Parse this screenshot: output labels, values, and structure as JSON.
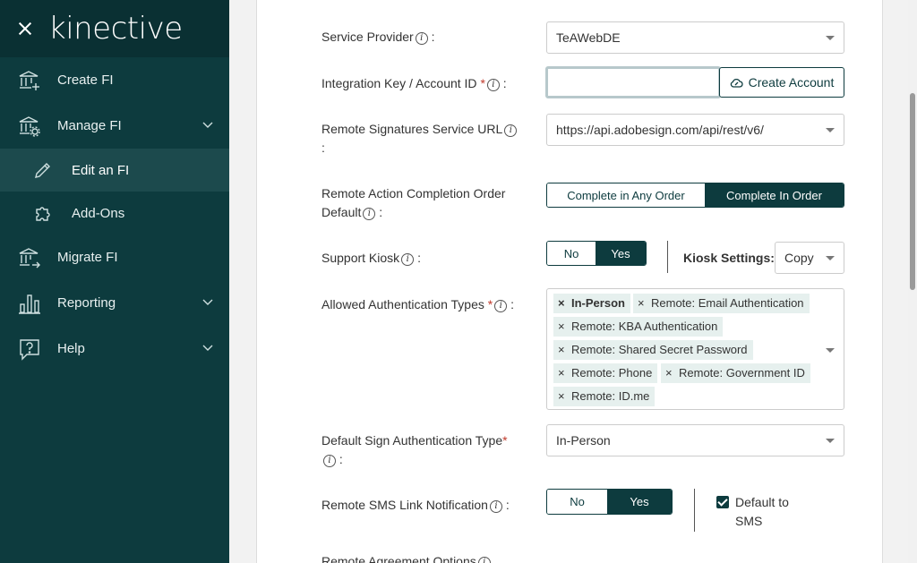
{
  "app": {
    "logo_text": "kinective"
  },
  "sidebar": {
    "items": [
      {
        "label": "Create FI",
        "icon": "bank-plus-icon"
      },
      {
        "label": "Manage FI",
        "icon": "bank-gear-icon",
        "expanded": true
      },
      {
        "label": "Edit an FI",
        "icon": "pencil-icon",
        "active": true
      },
      {
        "label": "Add-Ons",
        "icon": "puzzle-icon"
      },
      {
        "label": "Migrate FI",
        "icon": "bank-arrow-icon"
      },
      {
        "label": "Reporting",
        "icon": "bar-chart-icon"
      },
      {
        "label": "Help",
        "icon": "question-bubble-icon"
      }
    ]
  },
  "form": {
    "service_provider": {
      "label": "Service Provider",
      "suffix": ":",
      "value": "TeAWebDE"
    },
    "integration_key": {
      "label": "Integration Key / Account ID",
      "required_mark": "*",
      "suffix": ":",
      "value": "",
      "button": "Create Account"
    },
    "remote_sig_url": {
      "label": "Remote Signatures Service URL",
      "suffix": ":",
      "value": "https://api.adobesign.com/api/rest/v6/"
    },
    "completion_order": {
      "label_line1": "Remote Action Completion Order",
      "label_line2": "Default",
      "suffix": ":",
      "options": [
        "Complete in Any Order",
        "Complete In Order"
      ],
      "selected": "Complete In Order"
    },
    "support_kiosk": {
      "label": "Support Kiosk",
      "suffix": ":",
      "options": [
        "No",
        "Yes"
      ],
      "selected": "Yes",
      "settings_label": "Kiosk Settings:",
      "settings_value": "Copy"
    },
    "auth_types": {
      "label": "Allowed Authentication Types",
      "required_mark": "*",
      "suffix": ":",
      "tags": [
        "In-Person",
        "Remote: Email Authentication",
        "Remote: KBA Authentication",
        "Remote: Shared Secret Password",
        "Remote: Phone",
        "Remote: Government ID",
        "Remote: ID.me"
      ],
      "remove_glyph": "×"
    },
    "default_sign_auth": {
      "label": "Default Sign Authentication Type",
      "required_mark": "*",
      "suffix": ":",
      "value": "In-Person"
    },
    "sms_link": {
      "label": "Remote SMS Link Notification",
      "suffix": ":",
      "options": [
        "No",
        "Yes"
      ],
      "selected": "Yes",
      "default_label_line1": "Default to",
      "default_label_line2": "SMS",
      "default_checked": true
    },
    "agreement_options": {
      "label": "Remote Agreement Options"
    }
  },
  "colors": {
    "sidebar_bg": "#0d3b3e",
    "header_bg": "#0a3033",
    "active_item_bg": "#1c4a4d",
    "accent": "#0d3b3e",
    "tag_bg": "#e6f0ee",
    "required": "#c0392b"
  }
}
